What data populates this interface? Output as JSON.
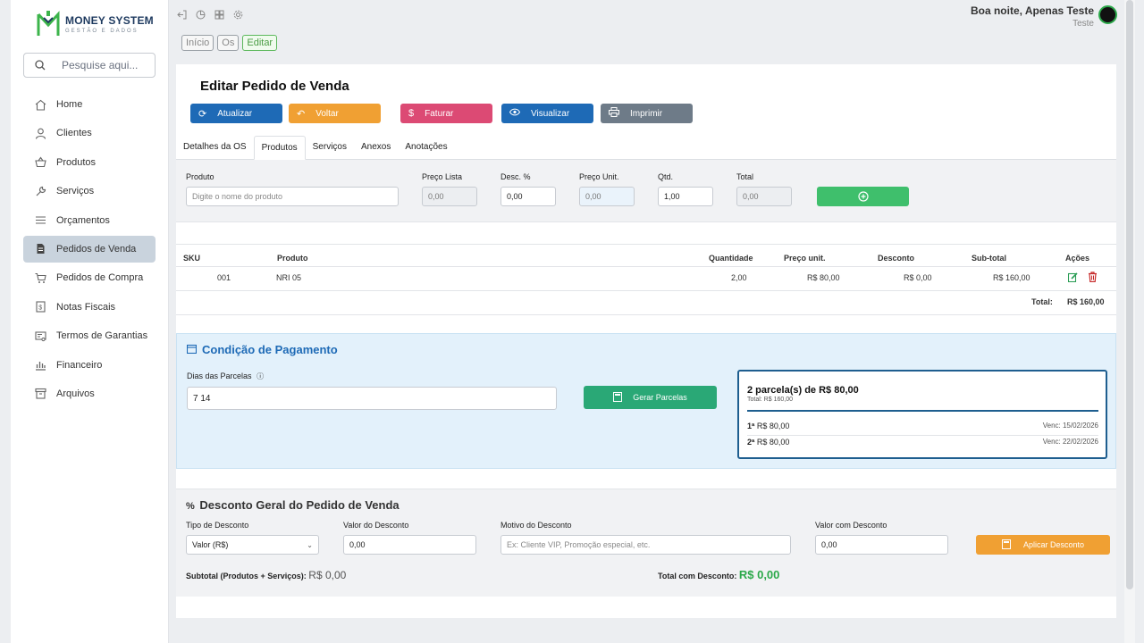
{
  "brand": {
    "title": "MONEY SYSTEM",
    "subtitle": "GESTÃO E DADOS"
  },
  "search": {
    "placeholder": "Pesquise aqui..."
  },
  "sidebar": {
    "items": [
      {
        "label": "Home",
        "icon": "home-icon"
      },
      {
        "label": "Clientes",
        "icon": "user-icon"
      },
      {
        "label": "Produtos",
        "icon": "basket-icon"
      },
      {
        "label": "Serviços",
        "icon": "wrench-icon"
      },
      {
        "label": "Orçamentos",
        "icon": "list-icon"
      },
      {
        "label": "Pedidos de Venda",
        "icon": "document-icon",
        "active": true
      },
      {
        "label": "Pedidos de Compra",
        "icon": "cart-icon"
      },
      {
        "label": "Notas Fiscais",
        "icon": "dollar-doc-icon"
      },
      {
        "label": "Termos de Garantias",
        "icon": "certificate-icon"
      },
      {
        "label": "Financeiro",
        "icon": "bank-icon"
      },
      {
        "label": "Arquivos",
        "icon": "archive-icon"
      }
    ]
  },
  "user": {
    "greeting": "Boa noite, Apenas Teste",
    "role": "Teste"
  },
  "breadcrumbs": [
    "Início",
    "Os",
    "Editar"
  ],
  "page": {
    "title": "Editar Pedido de Venda"
  },
  "actions": {
    "atualizar": "Atualizar",
    "voltar": "Voltar",
    "faturar": "Faturar",
    "visualizar": "Visualizar",
    "imprimir": "Imprimir"
  },
  "tabs": [
    "Detalhes da OS",
    "Produtos",
    "Serviços",
    "Anexos",
    "Anotações"
  ],
  "product_form": {
    "produto_label": "Produto",
    "produto_placeholder": "Digite o nome do produto",
    "preco_lista_label": "Preço Lista",
    "preco_lista_value": "0,00",
    "desc_label": "Desc. %",
    "desc_value": "0,00",
    "preco_unit_label": "Preço Unit.",
    "preco_unit_value": "0,00",
    "qtd_label": "Qtd.",
    "qtd_value": "1,00",
    "total_label": "Total",
    "total_value": "0,00"
  },
  "items_table": {
    "headers": [
      "SKU",
      "Produto",
      "Quantidade",
      "Preço unit.",
      "Desconto",
      "Sub-total",
      "Ações"
    ],
    "rows": [
      {
        "sku": "001",
        "produto": "NRI 05",
        "quantidade": "2,00",
        "preco": "R$ 80,00",
        "desconto": "R$ 0,00",
        "subtotal": "R$ 160,00"
      }
    ],
    "total_label": "Total:",
    "total_value": "R$ 160,00"
  },
  "payment": {
    "title": "Condição de Pagamento",
    "dias_label": "Dias das Parcelas",
    "dias_value": "7 14",
    "gerar_label": "Gerar Parcelas",
    "summary_title": "2 parcela(s) de R$ 80,00",
    "summary_total": "Total: R$ 160,00",
    "installments": [
      {
        "num": "1ª",
        "value": "R$ 80,00",
        "venc": "Venc: 15/02/2026"
      },
      {
        "num": "2ª",
        "value": "R$ 80,00",
        "venc": "Venc: 22/02/2026"
      }
    ]
  },
  "discount": {
    "title": "Desconto Geral do Pedido de Venda",
    "tipo_label": "Tipo de Desconto",
    "tipo_value": "Valor (R$)",
    "valor_label": "Valor do Desconto",
    "valor_value": "0,00",
    "motivo_label": "Motivo do Desconto",
    "motivo_placeholder": "Ex: Cliente VIP, Promoção especial, etc.",
    "valor_com_label": "Valor com Desconto",
    "valor_com_value": "0,00",
    "aplicar_label": "Aplicar Desconto",
    "subtotal_label": "Subtotal (Produtos + Serviços):",
    "subtotal_value": "R$ 0,00",
    "total_label": "Total com Desconto:",
    "total_value": "R$ 0,00"
  },
  "colors": {
    "primary": "#1e6ab6",
    "orange": "#f0a033",
    "pink": "#dc4a74",
    "gray": "#6e7b88",
    "green": "#3fbf6c",
    "teal": "#2aa876"
  }
}
